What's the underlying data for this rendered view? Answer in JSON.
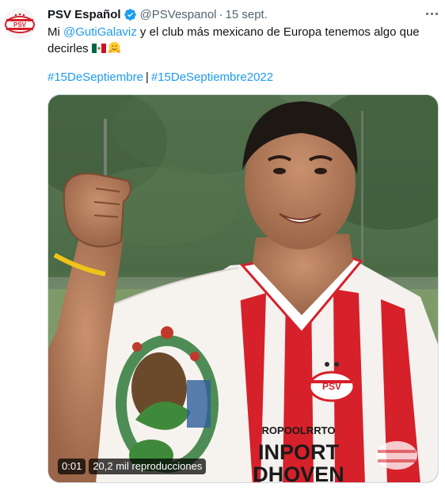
{
  "tweet": {
    "display_name": "PSV Español",
    "handle": "@PSVespanol",
    "separator": "·",
    "date": "15 sept.",
    "text_prefix": "Mi ",
    "mention": "@GutiGalaviz",
    "text_suffix": " y el club más mexicano de Europa tenemos algo que decirles",
    "hashtag_1": "#15DeSeptiembre",
    "hashtag_separator": "|",
    "hashtag_2": "#15DeSeptiembre2022"
  },
  "video": {
    "elapsed": "0:01",
    "views": "20,2 mil reproducciones",
    "jersey_line_1": "ROPOOLRRTO",
    "jersey_line_2": "INPORT",
    "jersey_line_3": "DHOVEN",
    "crest_text": "PSV"
  },
  "avatar": {
    "text": "PSV"
  },
  "colors": {
    "accent": "#1d9bf0",
    "text": "#0f1419",
    "secondary": "#536471",
    "psv_red": "#d6202a"
  },
  "icons": {
    "verified": "verified-badge-icon",
    "more": "more-options-icon",
    "flag": "mexico-flag-emoji",
    "hug": "hugging-face-emoji"
  }
}
